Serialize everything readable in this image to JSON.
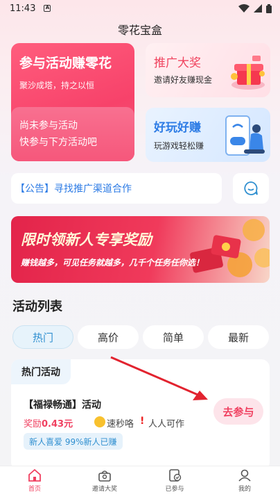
{
  "status": {
    "time": "11:43",
    "badge": "A"
  },
  "app": {
    "title": "零花宝盒"
  },
  "cards": {
    "join": {
      "title": "参与活动赚零花",
      "subtitle": "聚沙成塔，持之以恒",
      "line1": "尚未参与活动",
      "line2": "快参与下方活动吧"
    },
    "promo": {
      "title": "推广大奖",
      "subtitle": "邀请好友赚现金"
    },
    "game": {
      "title": "好玩好赚",
      "subtitle": "玩游戏轻松赚"
    }
  },
  "notice": {
    "text": "【公告】寻找推广渠道合作"
  },
  "banner": {
    "title": "限时领新人专享奖励",
    "subtitle": "赚钱越多，可见任务就越多，几千个任务任你选！"
  },
  "activity_list": {
    "title": "活动列表",
    "tabs": [
      {
        "label": "热门"
      },
      {
        "label": "高价"
      },
      {
        "label": "简单"
      },
      {
        "label": "最新"
      }
    ],
    "active_tab": "热门",
    "panel_title": "热门活动",
    "items": [
      {
        "title": "【福禄畅通】活动",
        "reward_label": "奖励",
        "reward_value": "0.43元",
        "quick": "速秒咯",
        "anyone": "人人可作",
        "tag": "新人喜爱  99%新人已赚",
        "button": "去参与"
      }
    ]
  },
  "bottom_nav": [
    {
      "label": "首页",
      "icon": "home-icon"
    },
    {
      "label": "邀请大奖",
      "icon": "gift-icon"
    },
    {
      "label": "已参与",
      "icon": "joined-icon"
    },
    {
      "label": "我的",
      "icon": "user-icon"
    }
  ],
  "colors": {
    "accent": "#f04060",
    "blue": "#2f8fd0"
  }
}
